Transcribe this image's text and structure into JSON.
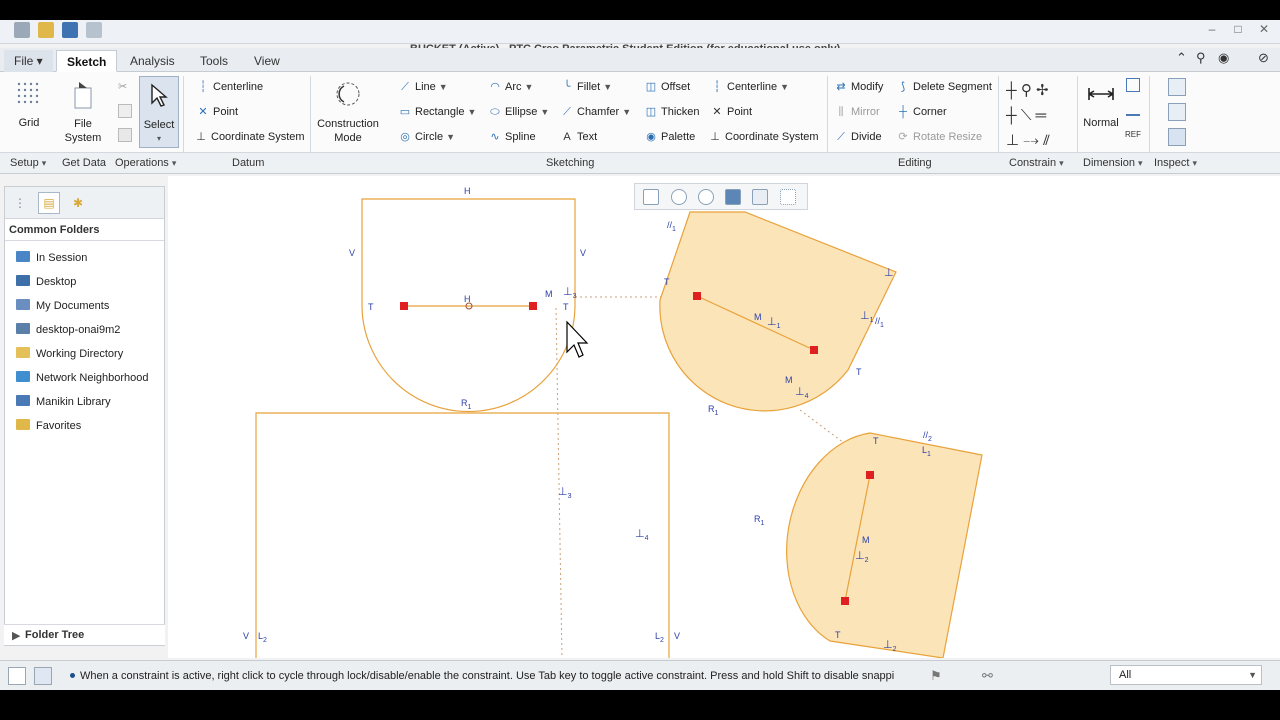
{
  "window": {
    "title": "BUCKET (Active) - PTC Creo Parametric Student Edition (for educational use only)"
  },
  "tabs": [
    {
      "label": "File ▾"
    },
    {
      "label": "Sketch"
    },
    {
      "label": "Analysis"
    },
    {
      "label": "Tools"
    },
    {
      "label": "View"
    }
  ],
  "ribbon": {
    "setup": {
      "grid": "Grid",
      "file_system": "File System",
      "select": "Select"
    },
    "datum": {
      "centerline": "Centerline",
      "point": "Point",
      "coordinate_system": "Coordinate System"
    },
    "construction": {
      "label1": "Construction",
      "label2": "Mode"
    },
    "sketching": {
      "line": "Line",
      "arc": "Arc",
      "fillet": "Fillet",
      "offset": "Offset",
      "centerline": "Centerline",
      "rectangle": "Rectangle",
      "ellipse": "Ellipse",
      "chamfer": "Chamfer",
      "thicken": "Thicken",
      "point": "Point",
      "circle": "Circle",
      "spline": "Spline",
      "text": "Text",
      "palette": "Palette",
      "coordinate_system": "Coordinate System"
    },
    "editing": {
      "modify": "Modify",
      "delete_segment": "Delete Segment",
      "mirror": "Mirror",
      "corner": "Corner",
      "divide": "Divide",
      "rotate_resize": "Rotate Resize"
    },
    "dimension": {
      "normal": "Normal"
    },
    "groups": {
      "setup": "Setup",
      "get_data": "Get Data",
      "operations": "Operations",
      "datum": "Datum",
      "sketching": "Sketching",
      "editing": "Editing",
      "constrain": "Constrain",
      "dimension": "Dimension",
      "inspect": "Inspect"
    }
  },
  "navigator": {
    "header": "Common Folders",
    "items": [
      {
        "label": "In Session",
        "icon": "monitor-icon",
        "color": "#4a86c5"
      },
      {
        "label": "Desktop",
        "icon": "desktop-icon",
        "color": "#3d6fa8"
      },
      {
        "label": "My Documents",
        "icon": "documents-icon",
        "color": "#6a8ebf"
      },
      {
        "label": "desktop-onai9m2",
        "icon": "computer-icon",
        "color": "#5a7fa8"
      },
      {
        "label": "Working Directory",
        "icon": "folder-icon",
        "color": "#e3c05a"
      },
      {
        "label": "Network Neighborhood",
        "icon": "network-icon",
        "color": "#3f8fd0"
      },
      {
        "label": "Manikin Library",
        "icon": "library-icon",
        "color": "#4a7ab5"
      },
      {
        "label": "Favorites",
        "icon": "favorites-icon",
        "color": "#e0b84a"
      }
    ],
    "folder_tree": "Folder Tree"
  },
  "canvas": {
    "labels": {
      "H": "H",
      "V": "V",
      "T": "T",
      "M": "M",
      "R1": "R",
      "L1": "L",
      "L2": "L",
      "sub1": "1",
      "sub2": "2",
      "sub3": "3",
      "sub4": "4",
      "par": "//"
    },
    "colors": {
      "sketch": "#e8a23a",
      "fill": "#fbe4b8",
      "point": "#e02020",
      "constraint": "#2b3ea8"
    }
  },
  "status": {
    "message": "When a constraint is active, right click to cycle through lock/disable/enable the constraint. Use Tab key to toggle active constraint. Press and hold Shift to disable snappi",
    "filter": "All"
  }
}
